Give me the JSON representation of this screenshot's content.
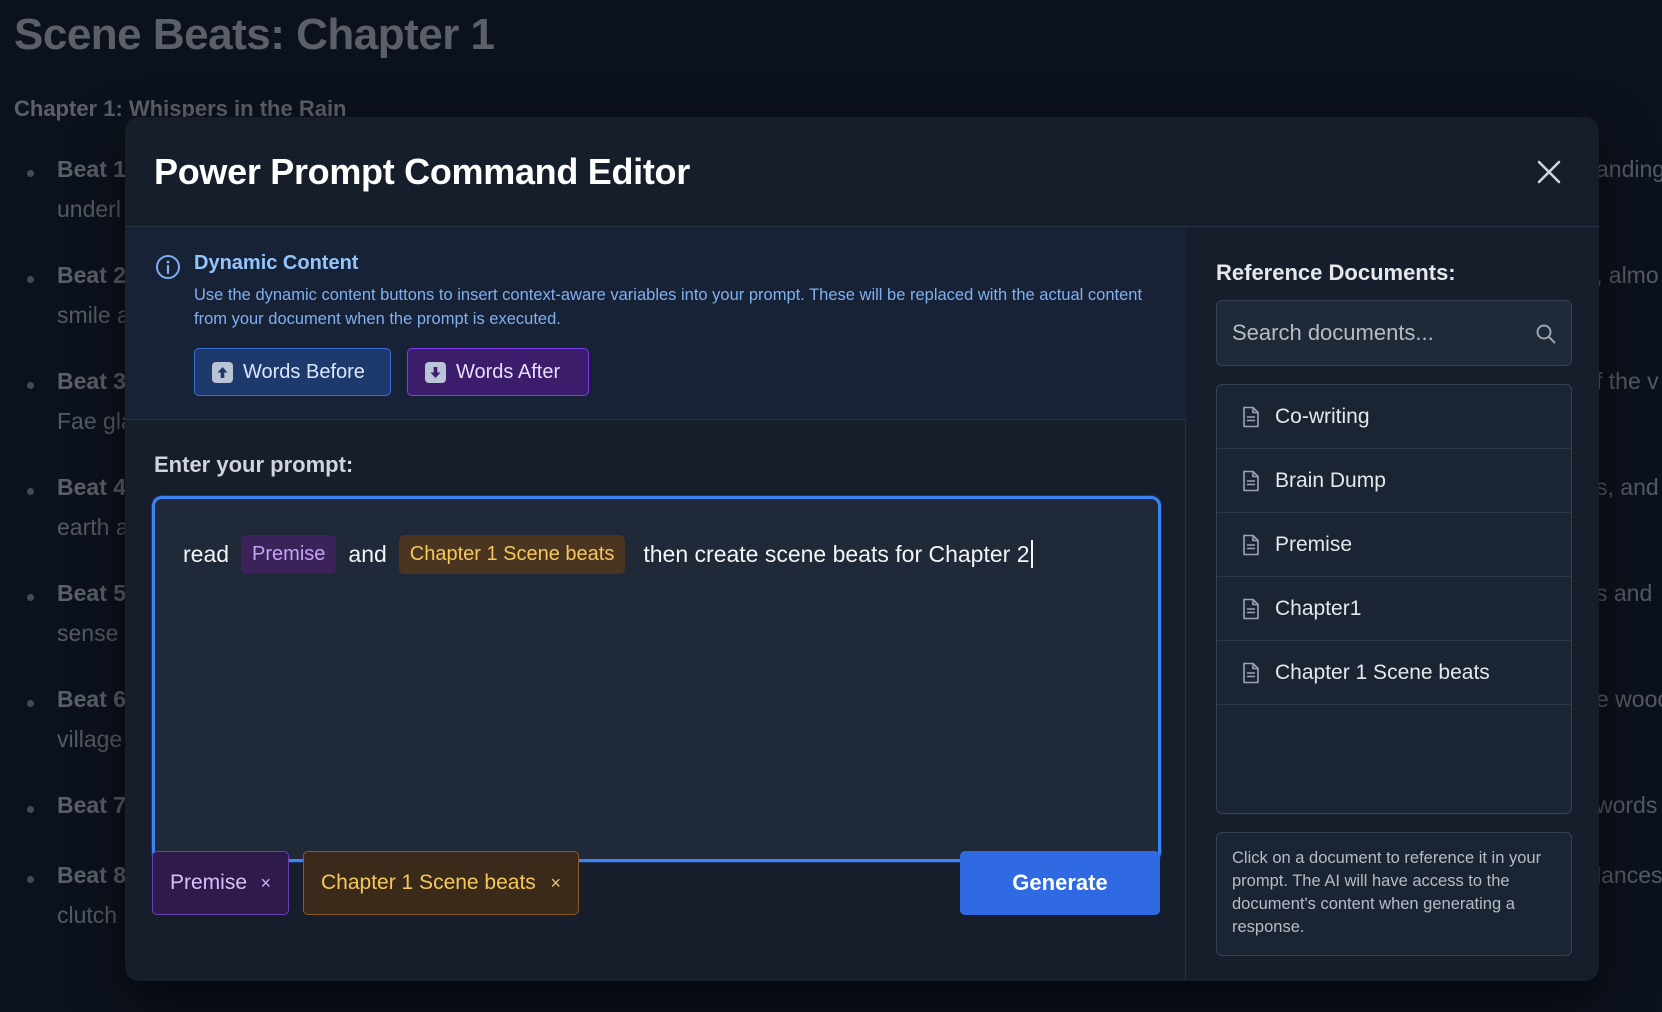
{
  "background": {
    "title": "Scene Beats: Chapter 1",
    "subtitle": "Chapter 1: Whispers in the Rain",
    "beats": [
      {
        "label": "Beat 1",
        "line2": "underl",
        "right": "anding"
      },
      {
        "label": "Beat 2",
        "line2": "smile a",
        "right": ", almo"
      },
      {
        "label": "Beat 3",
        "line2": "Fae gla",
        "right": "f the v"
      },
      {
        "label": "Beat 4",
        "line2": "earth a",
        "right": "s, and"
      },
      {
        "label": "Beat 5",
        "line2": "sense",
        "right": "s and"
      },
      {
        "label": "Beat 6",
        "line2": "village",
        "right": "e wooc"
      },
      {
        "label": "Beat 7",
        "line2": "",
        "right": "words a"
      },
      {
        "label": "Beat 8",
        "line2": "clutch",
        "right": "lances"
      }
    ]
  },
  "modal": {
    "title": "Power Prompt Command Editor",
    "dynamic_content": {
      "title": "Dynamic Content",
      "description": "Use the dynamic content buttons to insert context-aware variables into your prompt. These will be replaced with the actual content from your document when the prompt is executed.",
      "buttons": [
        {
          "label": "Words Before",
          "icon": "up-arrow-emoji-icon"
        },
        {
          "label": "Words After",
          "icon": "down-arrow-emoji-icon"
        }
      ]
    },
    "prompt": {
      "label": "Enter your prompt:",
      "segments": {
        "t1": "read",
        "chip1": "Premise",
        "t2": "and",
        "chip2": "Chapter 1 Scene beats",
        "t3": "then create scene beats for Chapter 2"
      }
    },
    "referenced_tags": [
      {
        "label": "Premise",
        "remove": "×"
      },
      {
        "label": "Chapter 1 Scene beats",
        "remove": "×"
      }
    ],
    "generate_label": "Generate",
    "reference": {
      "title": "Reference Documents:",
      "search_placeholder": "Search documents...",
      "documents": [
        "Co-writing",
        "Brain Dump",
        "Premise",
        "Chapter1",
        "Chapter 1 Scene beats"
      ],
      "help_text": "Click on a document to reference it in your prompt. The AI will have access to the document's content when generating a response."
    },
    "colors": {
      "accent": "#2f6ae3",
      "focus_border": "#3b82f6",
      "premise_chip": "#3b2259",
      "chapter_chip": "#4a3520"
    }
  }
}
